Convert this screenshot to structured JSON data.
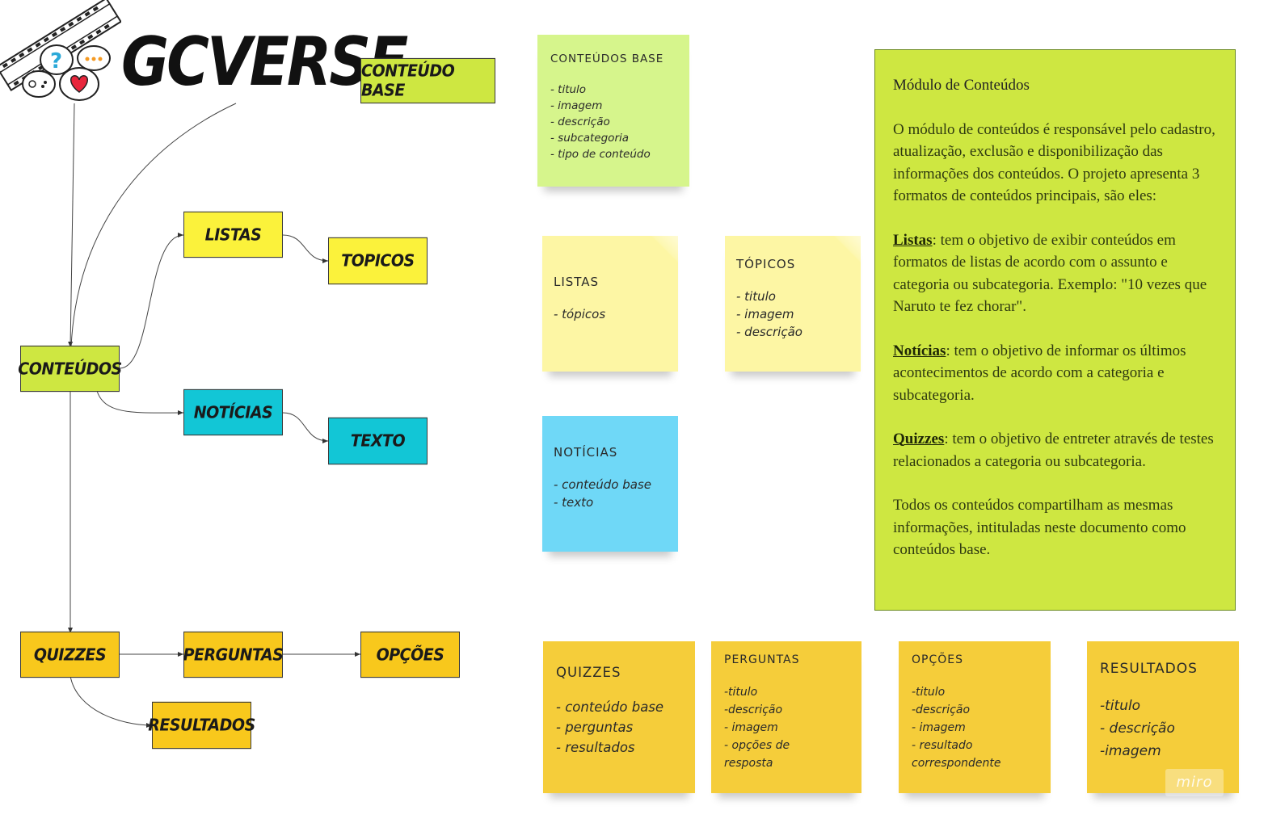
{
  "logo": {
    "text": "GCVERSE"
  },
  "colors": {
    "lime": "#cee741",
    "yellow": "#fbf23b",
    "cyan": "#12c6d6",
    "gold": "#f8c81c",
    "sticky_green": "#d6f58c",
    "sticky_yellow": "#fdf6a4",
    "sticky_blue": "#6fd8f7",
    "sticky_gold": "#f5cd3a"
  },
  "nodes": {
    "conteudo_base": "CONTEÚDO BASE",
    "listas": "LISTAS",
    "topicos": "TOPICOS",
    "conteudos": "CONTEÚDOS",
    "noticias": "NOTÍCIAS",
    "texto": "TEXTO",
    "quizzes": "QUIZZES",
    "perguntas": "PERGUNTAS",
    "opcoes": "OPÇÕES",
    "resultados": "RESULTADOS"
  },
  "stickies": {
    "base": {
      "title": "CONTEÚDOS BASE",
      "lines": [
        "- titulo",
        "- imagem",
        "- descrição",
        "- subcategoria",
        "- tipo de conteúdo"
      ]
    },
    "listas": {
      "title": "LISTAS",
      "lines": [
        "- tópicos"
      ]
    },
    "topicos": {
      "title": "TÓPICOS",
      "lines": [
        "- titulo",
        "- imagem",
        "- descrição"
      ]
    },
    "noticias": {
      "title": "NOTÍCIAS",
      "lines": [
        "- conteúdo base",
        "- texto"
      ]
    },
    "quizzes": {
      "title": "QUIZZES",
      "lines": [
        "- conteúdo base",
        "- perguntas",
        "- resultados"
      ]
    },
    "perguntas": {
      "title": "PERGUNTAS",
      "lines": [
        "-titulo",
        "-descrição",
        "- imagem",
        "- opções de",
        "resposta"
      ]
    },
    "opcoes": {
      "title": "OPÇÕES",
      "lines": [
        "-titulo",
        "-descrição",
        "- imagem",
        "- resultado",
        "correspondente"
      ]
    },
    "resultados": {
      "title": "RESULTADOS",
      "lines": [
        "-titulo",
        "- descrição",
        "-imagem"
      ]
    }
  },
  "panel": {
    "title": "Módulo de Conteúdos",
    "intro": "O módulo de conteúdos é responsável pelo cadastro, atualização, exclusão e disponibilização das informações dos conteúdos. O projeto apresenta 3 formatos de conteúdos principais, são eles:",
    "items": [
      {
        "term": "Listas",
        "text": ": tem o objetivo de exibir conteúdos em formatos de listas de acordo com o assunto e categoria ou subcategoria. Exemplo: \"10 vezes que Naruto te fez chorar\"."
      },
      {
        "term": "Notícias",
        "text": ": tem o objetivo de informar os últimos acontecimentos de acordo com a categoria e subcategoria."
      },
      {
        "term": "Quizzes",
        "text": ": tem o objetivo de entreter através de testes relacionados a categoria ou subcategoria."
      }
    ],
    "outro": "Todos os conteúdos compartilham as mesmas informações, intituladas neste documento como conteúdos base."
  },
  "watermark": "miro"
}
